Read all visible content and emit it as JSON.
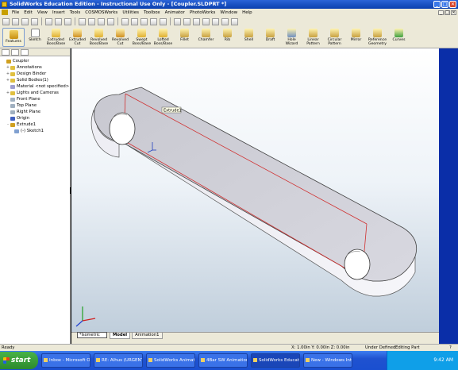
{
  "window": {
    "title": "SolidWorks Education Edition - Instructional Use Only - [Coupler.SLDPRT *]",
    "controls": [
      "_",
      "□",
      "✕"
    ]
  },
  "menubar": {
    "items": [
      "File",
      "Edit",
      "View",
      "Insert",
      "Tools",
      "COSMOSWorks",
      "Utilities",
      "Toolbox",
      "Animator",
      "PhotoWorks",
      "Window",
      "Help"
    ],
    "doc_controls": [
      "_",
      "□",
      "✕"
    ]
  },
  "ribbon": {
    "features_label": "Features",
    "sketch_label": "Sketch",
    "buttons": [
      {
        "label": "Extruded Boss/Base",
        "color": "#e0b030"
      },
      {
        "label": "Extruded Cut",
        "color": "#d09020"
      },
      {
        "label": "Revolved Boss/Base",
        "color": "#e0b030"
      },
      {
        "label": "Revolved Cut",
        "color": "#d09020"
      },
      {
        "label": "Swept Boss/Base",
        "color": "#e0b030"
      },
      {
        "label": "Lofted Boss/Base",
        "color": "#e0b030"
      },
      {
        "label": "Fillet",
        "color": "#c8a040"
      },
      {
        "label": "Chamfer",
        "color": "#c8a040"
      },
      {
        "label": "Rib",
        "color": "#c8a040"
      },
      {
        "label": "Shell",
        "color": "#c8a040"
      },
      {
        "label": "Draft",
        "color": "#c8a040"
      },
      {
        "label": "Hole Wizard",
        "color": "#7090c0"
      },
      {
        "label": "Linear Pattern",
        "color": "#c8a040"
      },
      {
        "label": "Circular Pattern",
        "color": "#c8a040"
      },
      {
        "label": "Mirror",
        "color": "#c8a040"
      },
      {
        "label": "Reference Geometry",
        "color": "#c8a040"
      },
      {
        "label": "Curves",
        "color": "#40a040"
      }
    ]
  },
  "tree": {
    "items": [
      {
        "label": "Coupler",
        "indent": 0,
        "exp": "",
        "color": "#d0a020"
      },
      {
        "label": "Annotations",
        "indent": 1,
        "exp": "+",
        "color": "#e0c040"
      },
      {
        "label": "Design Binder",
        "indent": 1,
        "exp": "+",
        "color": "#e0c040"
      },
      {
        "label": "Solid Bodies(1)",
        "indent": 1,
        "exp": "+",
        "color": "#e0c040"
      },
      {
        "label": "Material <not specified>",
        "indent": 1,
        "exp": "",
        "color": "#a0a0d0"
      },
      {
        "label": "Lights and Cameras",
        "indent": 1,
        "exp": "+",
        "color": "#e0c040"
      },
      {
        "label": "Front Plane",
        "indent": 1,
        "exp": "",
        "color": "#a0b0c0"
      },
      {
        "label": "Top Plane",
        "indent": 1,
        "exp": "",
        "color": "#a0b0c0"
      },
      {
        "label": "Right Plane",
        "indent": 1,
        "exp": "",
        "color": "#a0b0c0"
      },
      {
        "label": "Origin",
        "indent": 1,
        "exp": "",
        "color": "#4060c0"
      },
      {
        "label": "Extrude1",
        "indent": 1,
        "exp": "-",
        "color": "#d0a020"
      },
      {
        "label": "(-) Sketch1",
        "indent": 2,
        "exp": "",
        "color": "#80a0d0"
      }
    ]
  },
  "viewport": {
    "callout": "Extrude1",
    "view_selector": "*Isometric"
  },
  "bottom_tabs": [
    "Model",
    "Animation1"
  ],
  "status": {
    "left": "Ready",
    "coords": "X: 1.00in  Y: 0.00in  Z: 0.00in",
    "state": "Under Defined",
    "mode": "Editing Part",
    "help": "?"
  },
  "taskbar": {
    "start": "start",
    "tasks": [
      "Inbox - Microsoft O...",
      "RE: Alhus (URGENT...",
      "SolidWorks Animation",
      "4Bar SW Animation....",
      "SolidWorks Educati...",
      "New - Windows Inte..."
    ],
    "active_task": 4,
    "clock": "9:42 AM"
  }
}
